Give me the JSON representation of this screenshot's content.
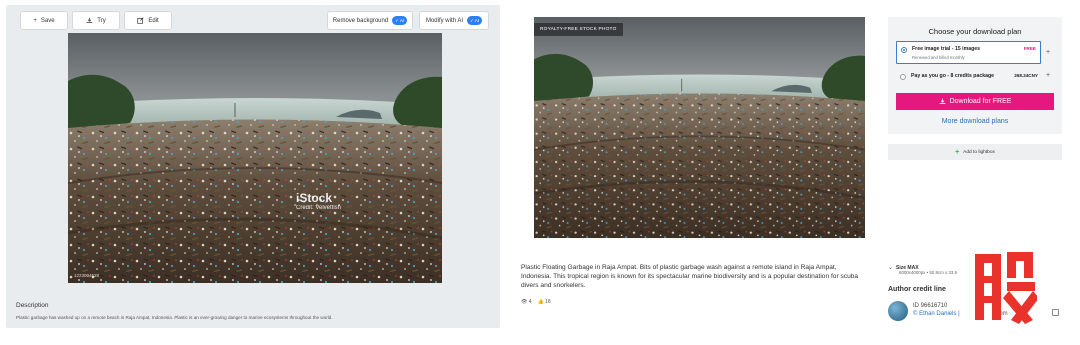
{
  "left_panel": {
    "toolbar": {
      "save_label": "Save",
      "try_label": "Try",
      "edit_label": "Edit",
      "remove_bg_label": "Remove background",
      "modify_ai_label": "Modify with AI",
      "ai_badge": "✓ AI"
    },
    "watermark": {
      "logo": "iStock",
      "credit": "Credit: Velvetfish",
      "id": "1223004628"
    },
    "description": {
      "heading": "Description",
      "text": "Plastic garbage has washed up on a remote beach in Raja Ampat, Indonesia. Plastic is an ever-growing danger to marine ecosystems throughout the world."
    }
  },
  "right_panel": {
    "photo_badge": "ROYALTY-FREE STOCK PHOTO",
    "plan_box": {
      "title": "Choose your download plan",
      "option1_title": "Free image trial - 15 images",
      "option1_sub": "Renewed and billed monthly",
      "option1_price": "FREE",
      "option2_title": "Pay as you go - 8 credits package",
      "option2_price": "268.24CNY",
      "download_label": "Download for FREE",
      "more_plans_label": "More download plans"
    },
    "lightbox_label": "Add to lightbox",
    "description": "Plastic Floating Garbage in Raja Ampat. Bits of plastic garbage wash against a remote island in Raja Ampat, Indonesia. This tropical region is known for its spectacular marine biodiversity and is a popular destination for scuba divers and snorkelers.",
    "stats": {
      "views": "4",
      "likes": "18"
    },
    "size": {
      "label": "Size MAX",
      "detail": "6000x4000px • 50.8cm x 33.9"
    },
    "author": {
      "heading": "Author credit line",
      "id": "ID 96616710",
      "name": "© Ethan Daniels |",
      "name_tail": "om"
    }
  },
  "colors": {
    "accent_blue": "#2d7ff9",
    "download_pink": "#e5197d",
    "link_blue": "#2a6ebd",
    "logo_red": "#e8322b"
  }
}
